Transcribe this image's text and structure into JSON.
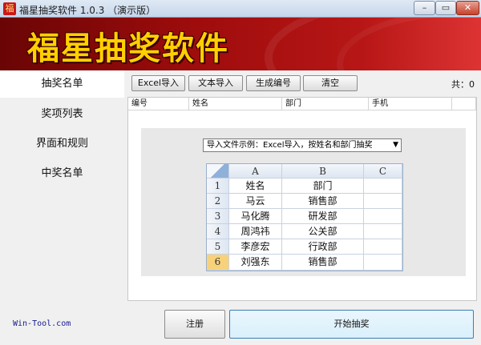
{
  "window": {
    "title": "福星抽奖软件 1.0.3 （演示版）",
    "icon": "app-logo-icon",
    "controls": {
      "minimize": "–",
      "maximize": "▭",
      "close": "✕"
    }
  },
  "banner": {
    "title": "福星抽奖软件"
  },
  "sidebar": {
    "items": [
      {
        "label": "抽奖名单"
      },
      {
        "label": "奖项列表"
      },
      {
        "label": "界面和规则"
      },
      {
        "label": "中奖名单"
      }
    ]
  },
  "toolbar": {
    "buttons": [
      "Excel导入",
      "文本导入",
      "生成编号",
      "清空"
    ],
    "count_label": "共：0"
  },
  "table": {
    "columns": [
      "编号",
      "姓名",
      "部门",
      "手机"
    ]
  },
  "example": {
    "select_value": "导入文件示例：Excel导入，按姓名和部门抽奖",
    "sheet": {
      "col_headers": [
        "A",
        "B",
        "C"
      ],
      "row_headers": [
        "1",
        "2",
        "3",
        "4",
        "5",
        "6"
      ],
      "rows": [
        [
          "姓名",
          "部门",
          ""
        ],
        [
          "马云",
          "销售部",
          ""
        ],
        [
          "马化腾",
          "研发部",
          ""
        ],
        [
          "周鸿祎",
          "公关部",
          ""
        ],
        [
          "李彦宏",
          "行政部",
          ""
        ],
        [
          "刘强东",
          "销售部",
          ""
        ]
      ]
    }
  },
  "footer": {
    "link": "Win-Tool.com",
    "register_label": "注册",
    "start_label": "开始抽奖"
  },
  "colors": {
    "banner": "#9e0c0c",
    "banner_text": "#ffd000",
    "selected_row_header": "#f7d27a"
  }
}
